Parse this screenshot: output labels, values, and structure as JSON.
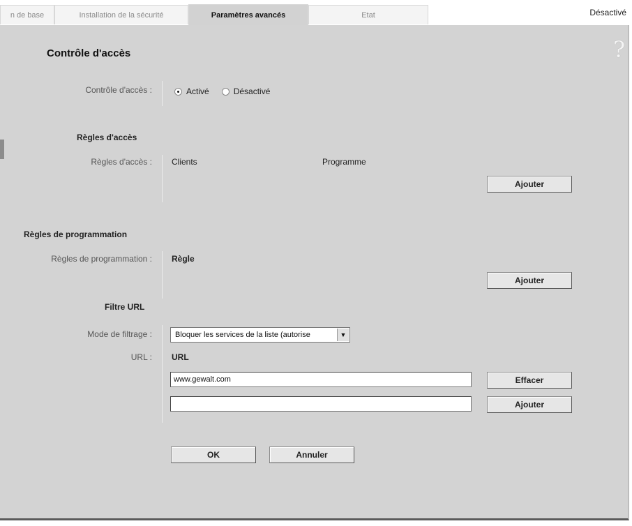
{
  "tabs": [
    {
      "label": "n de base",
      "active": false
    },
    {
      "label": "Installation de la sécurité",
      "active": false
    },
    {
      "label": "Paramètres avancés",
      "active": true
    },
    {
      "label": "Etat",
      "active": false
    }
  ],
  "status": "Désactivé",
  "help_icon": "?",
  "page_title": "Contrôle d'accès",
  "access_control": {
    "label": "Contrôle d'accès :",
    "option_on": "Activé",
    "option_off": "Désactivé",
    "selected": "on"
  },
  "access_rules": {
    "section_title": "Règles d'accès",
    "label": "Règles d'accès :",
    "col_clients": "Clients",
    "col_schedule": "Programme",
    "add_label": "Ajouter"
  },
  "schedule_rules": {
    "section_title": "Règles de programmation",
    "label": "Règles de programmation :",
    "col_rule": "Règle",
    "add_label": "Ajouter"
  },
  "url_filter": {
    "section_title": "Filtre URL",
    "mode_label": "Mode de filtrage :",
    "mode_value": "Bloquer les services de la liste (autorise",
    "url_label": "URL :",
    "col_url": "URL",
    "entry_value": "www.gewalt.com",
    "new_entry_value": "",
    "delete_label": "Effacer",
    "add_label": "Ajouter"
  },
  "footer": {
    "ok_label": "OK",
    "cancel_label": "Annuler"
  }
}
